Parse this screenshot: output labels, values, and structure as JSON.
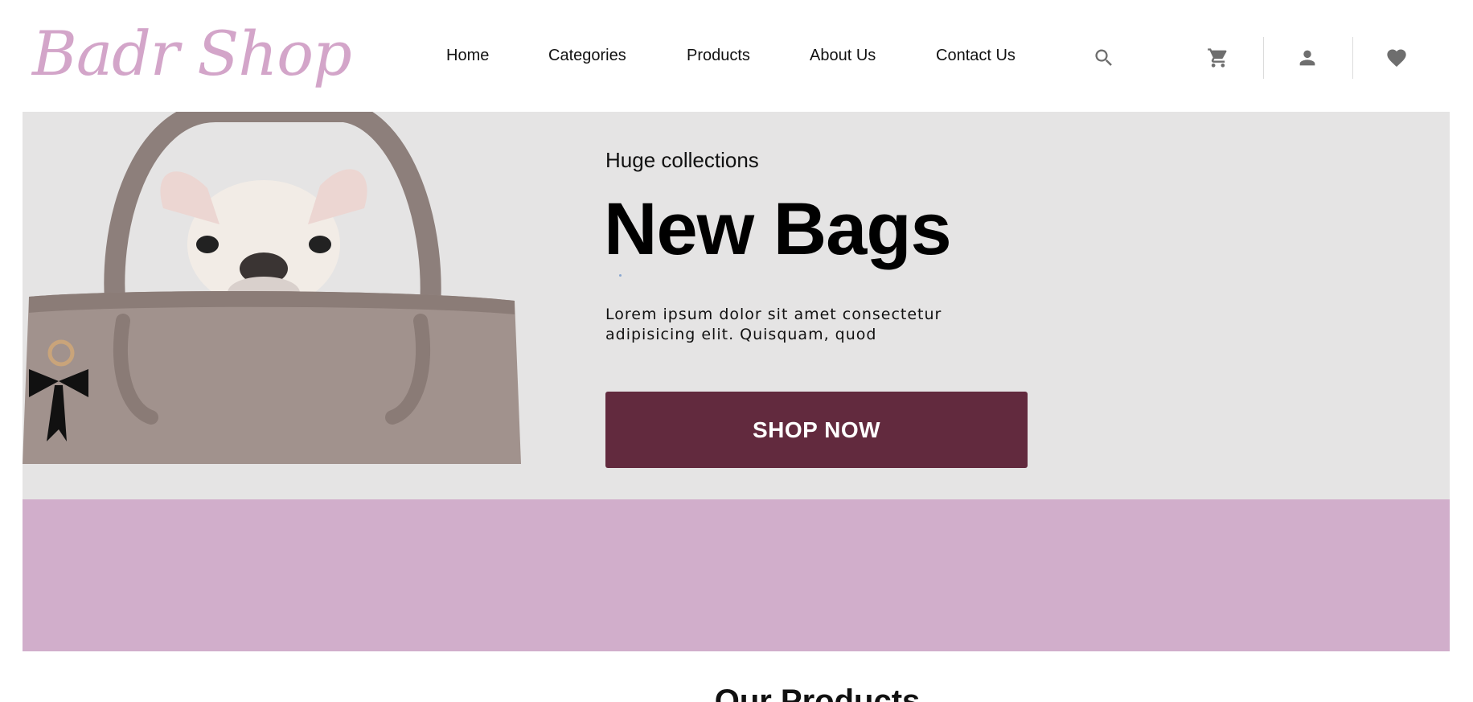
{
  "brand": {
    "logo_text": "Badr Shop"
  },
  "nav": {
    "items": [
      {
        "label": "Home"
      },
      {
        "label": "Categories"
      },
      {
        "label": "Products"
      },
      {
        "label": "About Us"
      },
      {
        "label": "Contact Us"
      }
    ]
  },
  "header_icons": [
    "search-icon",
    "cart-icon",
    "user-icon",
    "heart-icon"
  ],
  "hero": {
    "subtitle": "Huge collections",
    "title": "New Bags",
    "description": "Lorem ipsum dolor sit amet consectetur adipisicing elit. Quisquam, quod",
    "cta_label": "SHOP NOW",
    "background_color": "#e5e4e4",
    "cta_color": "#622a3e"
  },
  "band": {
    "color": "#d1aecb"
  },
  "products_section": {
    "title": "Our Products"
  },
  "colors": {
    "logo": "#d3a5c9",
    "icons": "#6e6e6e"
  }
}
